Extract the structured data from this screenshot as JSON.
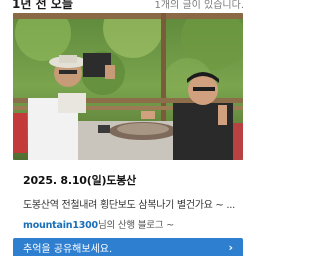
{
  "header": {
    "title": "1년 전 오늘",
    "count_text": "1개의 글이 있습니다."
  },
  "photo": {
    "description_icon": "hikers-photo"
  },
  "post": {
    "date_title": "2025. 8.10(일)도봉산",
    "description": "도봉산역 전철내려 횡단보도 삼복나기 별건가요 ~ ...",
    "blog_owner": "mountain1300",
    "blog_suffix": "님의 산행 블로그 ~"
  },
  "share": {
    "label": "추억을 공유해보세요.",
    "arrow": "›"
  },
  "colors": {
    "accent": "#2f7fd0",
    "link": "#1b6fb8"
  }
}
